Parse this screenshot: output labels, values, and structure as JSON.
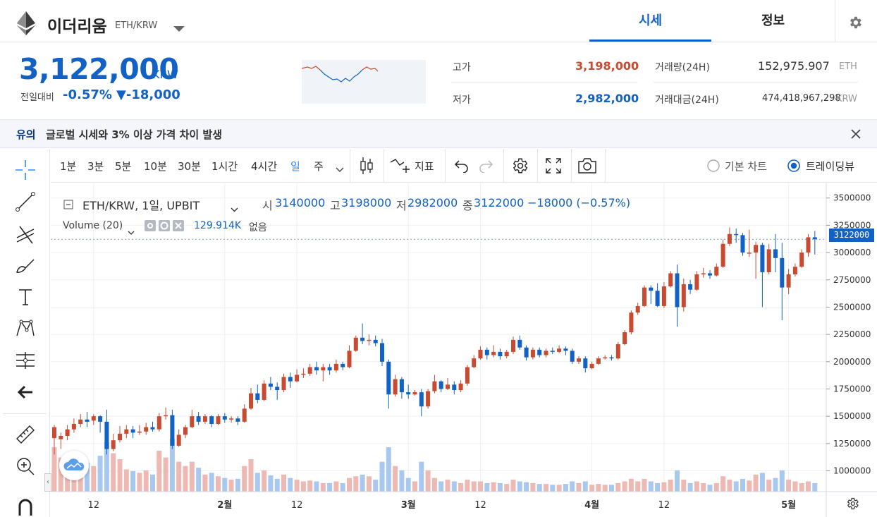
{
  "header": {
    "coin_name": "이더리움",
    "pair": "ETH/KRW",
    "tabs": [
      {
        "label": "시세",
        "active": true
      },
      {
        "label": "정보",
        "active": false
      }
    ],
    "icons": {
      "logo": "ethereum-logo-icon",
      "dropdown": "chevron-down-icon",
      "settings": "gear-icon"
    }
  },
  "price": {
    "current": "3,122,000",
    "unit": "KRW",
    "change_label": "전일대비",
    "change_rate": "-0.57%",
    "change_amount": "▼-18,000"
  },
  "stats": {
    "high_label": "고가",
    "high": "3,198,000",
    "low_label": "저가",
    "low": "2,982,000",
    "volume_label": "거래량(24H)",
    "volume": "152,975.907",
    "volume_unit": "ETH",
    "amount_label": "거래대금(24H)",
    "amount": "474,418,967,298",
    "amount_unit": "KRW"
  },
  "notice": {
    "tag": "유의",
    "message": "글로벌 시세와 3% 이상 가격 차이 발생"
  },
  "toolbar": {
    "intervals": [
      "1분",
      "3분",
      "5분",
      "10분",
      "30분",
      "1시간",
      "4시간",
      "일",
      "주"
    ],
    "active_interval": "일",
    "indicators_label": "지표",
    "chart_modes": [
      {
        "label": "기본 차트",
        "selected": false
      },
      {
        "label": "트레이딩뷰",
        "selected": true
      }
    ]
  },
  "legend": {
    "symbol": "ETH/KRW, 1일, UPBIT",
    "open_label": "시",
    "open": "3140000",
    "high_label": "고",
    "high": "3198000",
    "low_label": "저",
    "low": "2982000",
    "close_label": "종",
    "close": "3122000",
    "change": "−18000 (−0.57%)",
    "volume_label": "Volume (20)",
    "volume_value": "129.914K",
    "volume_extra": "없음"
  },
  "colors": {
    "up": "#c84a31",
    "down": "#1261c4",
    "up_volume": "#efb9b3",
    "down_volume": "#a9c8ef",
    "accent": "#093687"
  },
  "chart_data": {
    "type": "candlestick",
    "ylim": [
      900000,
      3550000
    ],
    "y_ticks": [
      1000000,
      1250000,
      1500000,
      1750000,
      2000000,
      2250000,
      2500000,
      2750000,
      3000000,
      3250000,
      3500000
    ],
    "x_ticks": [
      {
        "label": "12",
        "index": 6
      },
      {
        "label": "2월",
        "index": 26
      },
      {
        "label": "12",
        "index": 37
      },
      {
        "label": "3월",
        "index": 54
      },
      {
        "label": "12",
        "index": 65
      },
      {
        "label": "4월",
        "index": 82
      },
      {
        "label": "12",
        "index": 93
      },
      {
        "label": "5월",
        "index": 112
      }
    ],
    "last_price_label": "3122000",
    "last_price": 3122000,
    "first_x": 77,
    "candle_spacing": 9.3,
    "candles": [
      [
        1300000,
        1400000,
        1420000,
        1150000,
        52
      ],
      [
        1290000,
        1320000,
        1350000,
        1200000,
        40
      ],
      [
        1320000,
        1380000,
        1420000,
        1280000,
        35
      ],
      [
        1380000,
        1430000,
        1480000,
        1350000,
        30
      ],
      [
        1430000,
        1470000,
        1520000,
        1400000,
        28
      ],
      [
        1470000,
        1450000,
        1540000,
        1400000,
        34
      ],
      [
        1460000,
        1500000,
        1520000,
        1420000,
        30
      ],
      [
        1500000,
        1450000,
        1510000,
        1350000,
        42
      ],
      [
        1450000,
        1200000,
        1560000,
        1150000,
        58
      ],
      [
        1200000,
        1280000,
        1340000,
        1180000,
        45
      ],
      [
        1280000,
        1340000,
        1410000,
        1260000,
        38
      ],
      [
        1340000,
        1380000,
        1420000,
        1300000,
        26
      ],
      [
        1380000,
        1350000,
        1410000,
        1300000,
        24
      ],
      [
        1350000,
        1360000,
        1420000,
        1330000,
        22
      ],
      [
        1360000,
        1400000,
        1440000,
        1330000,
        25
      ],
      [
        1400000,
        1380000,
        1450000,
        1360000,
        20
      ],
      [
        1380000,
        1500000,
        1530000,
        1360000,
        48
      ],
      [
        1500000,
        1510000,
        1580000,
        1470000,
        40
      ],
      [
        1510000,
        1230000,
        1560000,
        1200000,
        62
      ],
      [
        1230000,
        1330000,
        1380000,
        1220000,
        35
      ],
      [
        1330000,
        1400000,
        1420000,
        1300000,
        30
      ],
      [
        1400000,
        1500000,
        1560000,
        1390000,
        35
      ],
      [
        1500000,
        1450000,
        1540000,
        1420000,
        28
      ],
      [
        1450000,
        1500000,
        1520000,
        1430000,
        20
      ],
      [
        1500000,
        1430000,
        1510000,
        1400000,
        22
      ],
      [
        1430000,
        1500000,
        1520000,
        1420000,
        18
      ],
      [
        1500000,
        1470000,
        1530000,
        1440000,
        16
      ],
      [
        1470000,
        1480000,
        1500000,
        1440000,
        14
      ],
      [
        1480000,
        1450000,
        1500000,
        1420000,
        15
      ],
      [
        1450000,
        1570000,
        1610000,
        1440000,
        30
      ],
      [
        1570000,
        1710000,
        1760000,
        1560000,
        38
      ],
      [
        1710000,
        1650000,
        1790000,
        1620000,
        22
      ],
      [
        1650000,
        1800000,
        1830000,
        1640000,
        25
      ],
      [
        1800000,
        1770000,
        1860000,
        1740000,
        19
      ],
      [
        1770000,
        1740000,
        1810000,
        1650000,
        15
      ],
      [
        1740000,
        1860000,
        1890000,
        1720000,
        20
      ],
      [
        1860000,
        1820000,
        1900000,
        1760000,
        16
      ],
      [
        1820000,
        1880000,
        1930000,
        1810000,
        14
      ],
      [
        1880000,
        1890000,
        1940000,
        1850000,
        12
      ],
      [
        1890000,
        1950000,
        1980000,
        1870000,
        13
      ],
      [
        1950000,
        1920000,
        2000000,
        1880000,
        12
      ],
      [
        1920000,
        1950000,
        1980000,
        1820000,
        10
      ],
      [
        1950000,
        1920000,
        1980000,
        1880000,
        10
      ],
      [
        1920000,
        1980000,
        2020000,
        1900000,
        12
      ],
      [
        1980000,
        1950000,
        2000000,
        1920000,
        10
      ],
      [
        1950000,
        2100000,
        2150000,
        1940000,
        16
      ],
      [
        2100000,
        2220000,
        2240000,
        2090000,
        18
      ],
      [
        2220000,
        2190000,
        2350000,
        2160000,
        20
      ],
      [
        2190000,
        2200000,
        2250000,
        2150000,
        18
      ],
      [
        2200000,
        2170000,
        2240000,
        2140000,
        14
      ],
      [
        2170000,
        2000000,
        2210000,
        1960000,
        35
      ],
      [
        2000000,
        1700000,
        2020000,
        1570000,
        52
      ],
      [
        1700000,
        1840000,
        1880000,
        1680000,
        30
      ],
      [
        1840000,
        1720000,
        1860000,
        1660000,
        25
      ],
      [
        1720000,
        1700000,
        1790000,
        1660000,
        16
      ],
      [
        1700000,
        1720000,
        1740000,
        1690000,
        12
      ],
      [
        1720000,
        1590000,
        1750000,
        1500000,
        35
      ],
      [
        1590000,
        1730000,
        1750000,
        1570000,
        25
      ],
      [
        1730000,
        1820000,
        1880000,
        1710000,
        16
      ],
      [
        1820000,
        1750000,
        1830000,
        1720000,
        12
      ],
      [
        1750000,
        1790000,
        1850000,
        1740000,
        14
      ],
      [
        1790000,
        1740000,
        1820000,
        1700000,
        12
      ],
      [
        1740000,
        1800000,
        1830000,
        1720000,
        10
      ],
      [
        1800000,
        1950000,
        1970000,
        1780000,
        14
      ],
      [
        1950000,
        2030000,
        2060000,
        1940000,
        12
      ],
      [
        2030000,
        2110000,
        2140000,
        2020000,
        12
      ],
      [
        2110000,
        2060000,
        2130000,
        2020000,
        10
      ],
      [
        2060000,
        2090000,
        2150000,
        2040000,
        11
      ],
      [
        2090000,
        2050000,
        2120000,
        2020000,
        10
      ],
      [
        2050000,
        2090000,
        2110000,
        2030000,
        9
      ],
      [
        2090000,
        2200000,
        2230000,
        2070000,
        14
      ],
      [
        2200000,
        2130000,
        2240000,
        2110000,
        12
      ],
      [
        2130000,
        2040000,
        2150000,
        2010000,
        11
      ],
      [
        2040000,
        2110000,
        2130000,
        2020000,
        10
      ],
      [
        2110000,
        2060000,
        2130000,
        2040000,
        9
      ],
      [
        2060000,
        2100000,
        2120000,
        2040000,
        9
      ],
      [
        2100000,
        2090000,
        2130000,
        2070000,
        8
      ],
      [
        2090000,
        2120000,
        2150000,
        2080000,
        8
      ],
      [
        2120000,
        2100000,
        2140000,
        2060000,
        9
      ],
      [
        2100000,
        2000000,
        2120000,
        1980000,
        12
      ],
      [
        2000000,
        2030000,
        2050000,
        1980000,
        10
      ],
      [
        2030000,
        1940000,
        2050000,
        1900000,
        12
      ],
      [
        1940000,
        1980000,
        2000000,
        1930000,
        8
      ],
      [
        1980000,
        2030000,
        2050000,
        1970000,
        9
      ],
      [
        2030000,
        2040000,
        2060000,
        2020000,
        8
      ],
      [
        2040000,
        2030000,
        2060000,
        2010000,
        8
      ],
      [
        2030000,
        2160000,
        2180000,
        2020000,
        10
      ],
      [
        2160000,
        2270000,
        2290000,
        2150000,
        12
      ],
      [
        2270000,
        2450000,
        2470000,
        2250000,
        15
      ],
      [
        2450000,
        2510000,
        2540000,
        2430000,
        12
      ],
      [
        2510000,
        2680000,
        2700000,
        2500000,
        15
      ],
      [
        2680000,
        2650000,
        2700000,
        2530000,
        12
      ],
      [
        2650000,
        2510000,
        2720000,
        2500000,
        10
      ],
      [
        2510000,
        2690000,
        2730000,
        2490000,
        11
      ],
      [
        2690000,
        2810000,
        2830000,
        2680000,
        14
      ],
      [
        2810000,
        2500000,
        2890000,
        2320000,
        25
      ],
      [
        2500000,
        2710000,
        2760000,
        2460000,
        14
      ],
      [
        2710000,
        2660000,
        2750000,
        2620000,
        10
      ],
      [
        2660000,
        2800000,
        2830000,
        2650000,
        12
      ],
      [
        2800000,
        2810000,
        2860000,
        2770000,
        10
      ],
      [
        2810000,
        2790000,
        2840000,
        2760000,
        8
      ],
      [
        2790000,
        2870000,
        2900000,
        2780000,
        10
      ],
      [
        2870000,
        3080000,
        3120000,
        2860000,
        18
      ],
      [
        3080000,
        3170000,
        3230000,
        3060000,
        14
      ],
      [
        3170000,
        3160000,
        3220000,
        3090000,
        12
      ],
      [
        3160000,
        3000000,
        3180000,
        2970000,
        15
      ],
      [
        3000000,
        3000000,
        3210000,
        2960000,
        13
      ],
      [
        3000000,
        3070000,
        3100000,
        2760000,
        20
      ],
      [
        3070000,
        2820000,
        3090000,
        2500000,
        22
      ],
      [
        2820000,
        3030000,
        3080000,
        2800000,
        14
      ],
      [
        3030000,
        2950000,
        3170000,
        2820000,
        16
      ],
      [
        2950000,
        2680000,
        3090000,
        2380000,
        25
      ],
      [
        2680000,
        2800000,
        2850000,
        2620000,
        14
      ],
      [
        2800000,
        2870000,
        2900000,
        2780000,
        12
      ],
      [
        2870000,
        3000000,
        3030000,
        2860000,
        10
      ],
      [
        3000000,
        3140000,
        3170000,
        2960000,
        12
      ],
      [
        3140000,
        3122000,
        3198000,
        2982000,
        10
      ]
    ]
  }
}
